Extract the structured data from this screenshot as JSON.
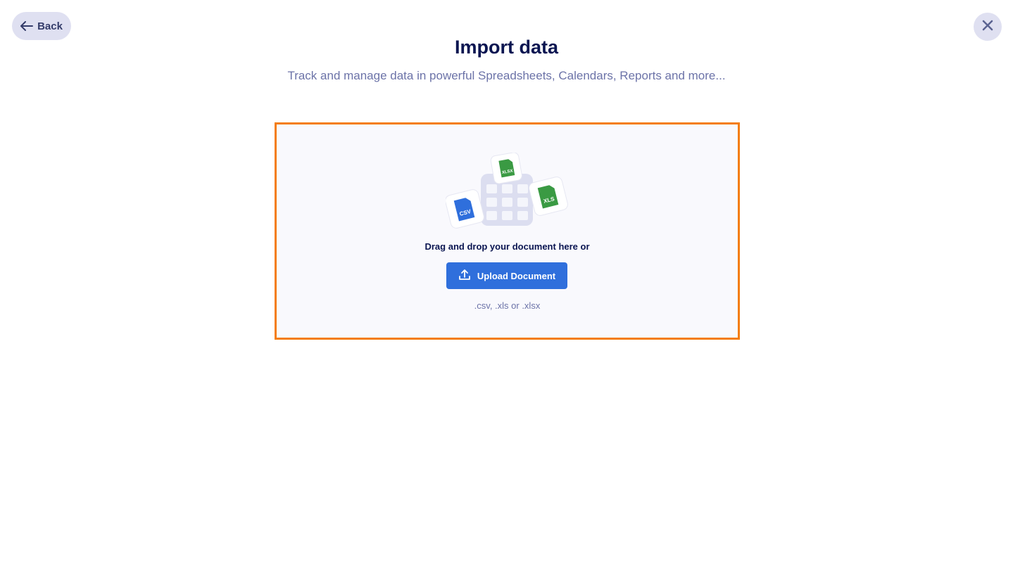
{
  "header": {
    "back_label": "Back",
    "title": "Import data",
    "subtitle": "Track and manage data in powerful Spreadsheets, Calendars, Reports and more..."
  },
  "dropzone": {
    "instruction": "Drag and drop your document here or",
    "upload_label": "Upload Document",
    "formats_hint": ".csv, .xls or .xlsx",
    "file_badges": [
      "CSV",
      "XLSX",
      "XLS"
    ]
  },
  "colors": {
    "title": "#0a1551",
    "subtitle": "#6c73a8",
    "accent_button": "#2f6fdc",
    "highlight_border": "#f47d0e",
    "csv_badge": "#2f6fdc",
    "excel_badge": "#3a9a43"
  },
  "icons": {
    "back": "arrow-left-icon",
    "close": "close-icon",
    "upload": "upload-icon"
  }
}
